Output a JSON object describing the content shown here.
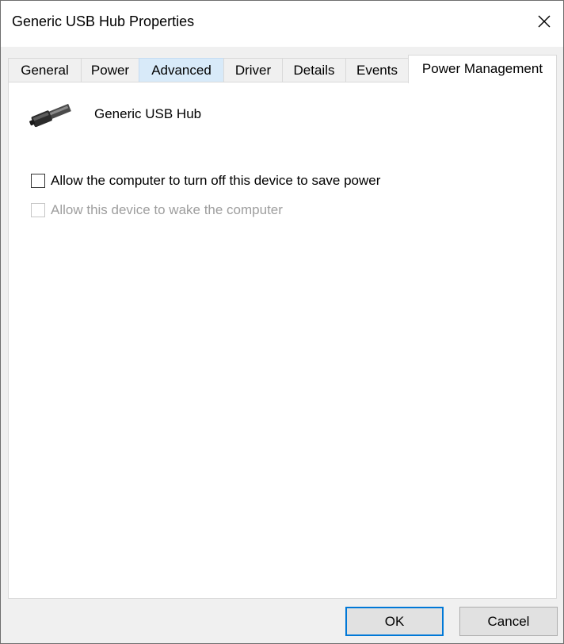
{
  "window": {
    "title": "Generic USB Hub Properties"
  },
  "tabs": [
    {
      "label": "General",
      "state": "normal"
    },
    {
      "label": "Power",
      "state": "normal"
    },
    {
      "label": "Advanced",
      "state": "hover"
    },
    {
      "label": "Driver",
      "state": "normal"
    },
    {
      "label": "Details",
      "state": "normal"
    },
    {
      "label": "Events",
      "state": "normal"
    },
    {
      "label": "Power Management",
      "state": "active"
    }
  ],
  "panel": {
    "device_icon": "usb-plug-icon",
    "device_name": "Generic USB Hub",
    "options": [
      {
        "label": "Allow the computer to turn off this device to save power",
        "checked": false,
        "enabled": true
      },
      {
        "label": "Allow this device to wake the computer",
        "checked": false,
        "enabled": false
      }
    ]
  },
  "buttons": {
    "ok": "OK",
    "cancel": "Cancel"
  },
  "colors": {
    "accent": "#0078d7",
    "tab_hover": "#d8eaf9",
    "disabled_text": "#9e9e9e"
  }
}
